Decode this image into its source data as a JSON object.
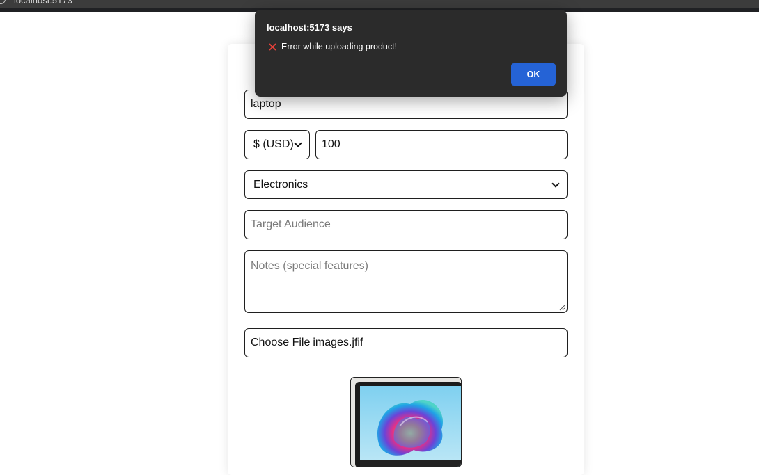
{
  "browser": {
    "url_text": "localhost:5173"
  },
  "form": {
    "product_name_value": "laptop",
    "currency_selected": "$ (USD)",
    "price_value": "100",
    "category_selected": "Electronics",
    "target_audience_placeholder": "Target Audience",
    "notes_placeholder": "Notes (special features)",
    "file_button_label": "Choose File",
    "file_name": "images.jfif"
  },
  "dialog": {
    "title": "localhost:5173 says",
    "message": "Error while uploading product!",
    "message_icon": "red-x-icon",
    "ok_label": "OK"
  },
  "colors": {
    "dialog_bg": "#2b2b2b",
    "ok_button": "#2563d6",
    "error_icon": "#e8413a"
  }
}
